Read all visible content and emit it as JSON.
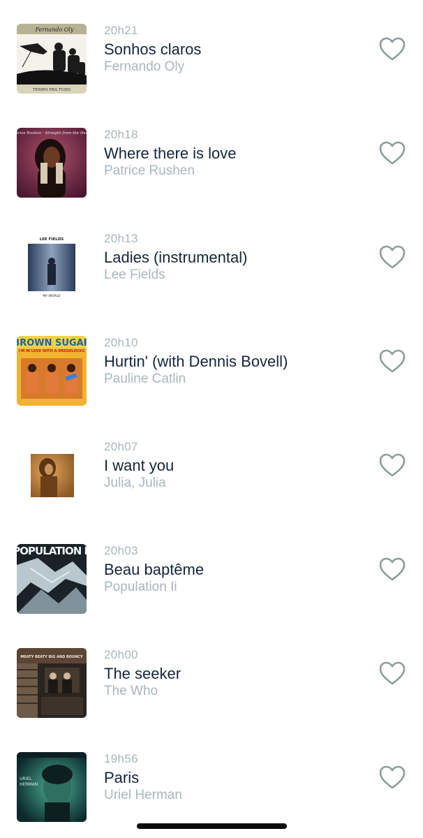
{
  "tracks": [
    {
      "time": "20h21",
      "title": "Sonhos claros",
      "artist": "Fernando Oly",
      "cover_icon": "album-cover-fernando-oly",
      "cover_lettering": [
        "Fernando Oly",
        "TEMPO PRA TUDO"
      ],
      "liked": false
    },
    {
      "time": "20h18",
      "title": "Where there is love",
      "artist": "Patrice Rushen",
      "cover_icon": "album-cover-patrice-rushen",
      "cover_lettering": [
        "Patrice Rushen",
        "Straight from the Heart"
      ],
      "liked": false
    },
    {
      "time": "20h13",
      "title": "Ladies (instrumental)",
      "artist": "Lee Fields",
      "cover_icon": "album-cover-lee-fields",
      "cover_lettering": [
        "LEE FIELDS",
        "MY WORLD"
      ],
      "liked": false
    },
    {
      "time": "20h10",
      "title": "Hurtin' (with Dennis Bovell)",
      "artist": "Pauline Catlin",
      "cover_icon": "album-cover-brown-sugar",
      "cover_lettering": [
        "BROWN SUGAR",
        "I'M IN LOVE WITH A DREADLOCKS"
      ],
      "liked": false
    },
    {
      "time": "20h07",
      "title": "I want you",
      "artist": "Julia, Julia",
      "cover_icon": "album-cover-julia-julia",
      "cover_lettering": [],
      "liked": false
    },
    {
      "time": "20h03",
      "title": "Beau baptême",
      "artist": "Population Ii",
      "cover_icon": "album-cover-population-ii",
      "cover_lettering": [
        "POPULATION II"
      ],
      "liked": false
    },
    {
      "time": "20h00",
      "title": "The seeker",
      "artist": "The Who",
      "cover_icon": "album-cover-the-who",
      "cover_lettering": [
        "MEATY BEATY BIG AND BOUNCY"
      ],
      "liked": false
    },
    {
      "time": "19h56",
      "title": "Paris",
      "artist": "Uriel Herman",
      "cover_icon": "album-cover-uriel-herman",
      "cover_lettering": [
        "URIEL HERMAN"
      ],
      "liked": false
    }
  ],
  "colors": {
    "title": "#14253d",
    "meta": "#a9b7bd",
    "heart_outline": "#8e9c9f",
    "background": "#ffffff",
    "home_indicator": "#0a0a0a"
  },
  "icons": {
    "like": "heart-outline-icon"
  }
}
